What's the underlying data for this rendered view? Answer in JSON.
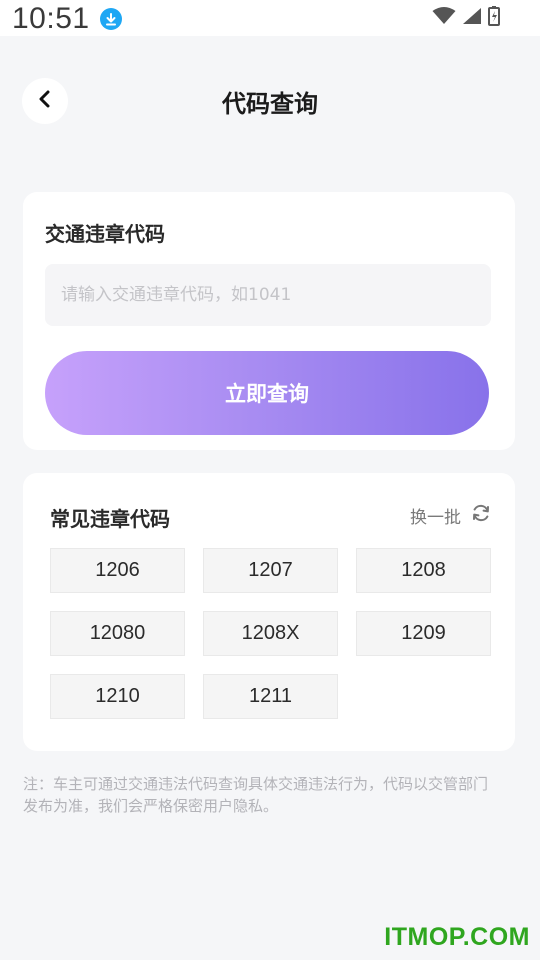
{
  "status_bar": {
    "time": "10:51",
    "icons": [
      "download-icon",
      "wifi-icon",
      "signal-icon",
      "battery-icon"
    ]
  },
  "header": {
    "title": "代码查询",
    "back_icon": "chevron-left-icon"
  },
  "query": {
    "label": "交通违章代码",
    "input_value": "",
    "input_placeholder": "请输入交通违章代码，如1041",
    "button_label": "立即查询",
    "button_gradient": [
      "#c6a1fb",
      "#8872ea"
    ]
  },
  "common": {
    "title": "常见违章代码",
    "refresh_label": "换一批",
    "codes": [
      "1206",
      "1207",
      "1208",
      "12080",
      "1208X",
      "1209",
      "1210",
      "1211"
    ]
  },
  "note": "注：车主可通过交通违法代码查询具体交通违法行为，代码以交管部门发布为准，我们会严格保密用户隐私。",
  "watermark": "ITMOP.COM"
}
